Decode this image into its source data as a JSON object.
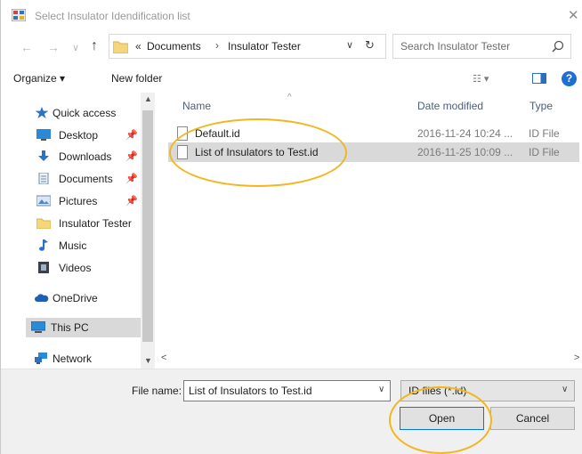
{
  "window": {
    "title": "Select Insulator Idendification list",
    "close_glyph": "✕"
  },
  "address": {
    "chevron": "«",
    "crumbs": [
      "Documents",
      "Insulator Tester"
    ],
    "separator": "›",
    "dropdown_glyph": "∨",
    "refresh_glyph": "↻"
  },
  "nav": {
    "back_glyph": "←",
    "forward_glyph": "→",
    "recent_glyph": "∨",
    "up_glyph": "↑"
  },
  "search": {
    "placeholder": "Search Insulator Tester"
  },
  "toolbar": {
    "organize": "Organize ▾",
    "new_folder": "New folder",
    "view_glyph": "☷ ▾",
    "help_glyph": "?"
  },
  "sidebar": {
    "pin_glyph": "📌",
    "items": [
      {
        "label": "Quick access",
        "icon": "star-icon"
      },
      {
        "label": "Desktop",
        "icon": "desktop-icon",
        "pinned": true
      },
      {
        "label": "Downloads",
        "icon": "download-icon",
        "pinned": true
      },
      {
        "label": "Documents",
        "icon": "documents-icon",
        "pinned": true
      },
      {
        "label": "Pictures",
        "icon": "pictures-icon",
        "pinned": true
      },
      {
        "label": "Insulator Tester",
        "icon": "folder-icon"
      },
      {
        "label": "Music",
        "icon": "music-icon"
      },
      {
        "label": "Videos",
        "icon": "video-icon"
      },
      {
        "label": "OneDrive",
        "icon": "cloud-icon"
      },
      {
        "label": "This PC",
        "icon": "computer-icon"
      },
      {
        "label": "Network",
        "icon": "network-icon"
      }
    ]
  },
  "file_list": {
    "columns": [
      "Name",
      "Date modified",
      "Type"
    ],
    "sort_glyph": "^",
    "rows": [
      {
        "name": "Default.id",
        "date": "2016-11-24 10:24 ...",
        "type": "ID File"
      },
      {
        "name": "List of Insulators to Test.id",
        "date": "2016-11-25 10:09 ...",
        "type": "ID File"
      }
    ]
  },
  "scroll": {
    "left": "<",
    "right": ">",
    "up": "▲",
    "down": "▼"
  },
  "footer": {
    "file_name_label": "File name:",
    "file_name_value": "List of Insulators to Test.id",
    "filter_value": "ID files (*.id)",
    "open": "Open",
    "cancel": "Cancel"
  },
  "colors": {
    "accent": "#0078d7",
    "annotation": "#f2b61f",
    "selection": "#d9d9d9"
  }
}
